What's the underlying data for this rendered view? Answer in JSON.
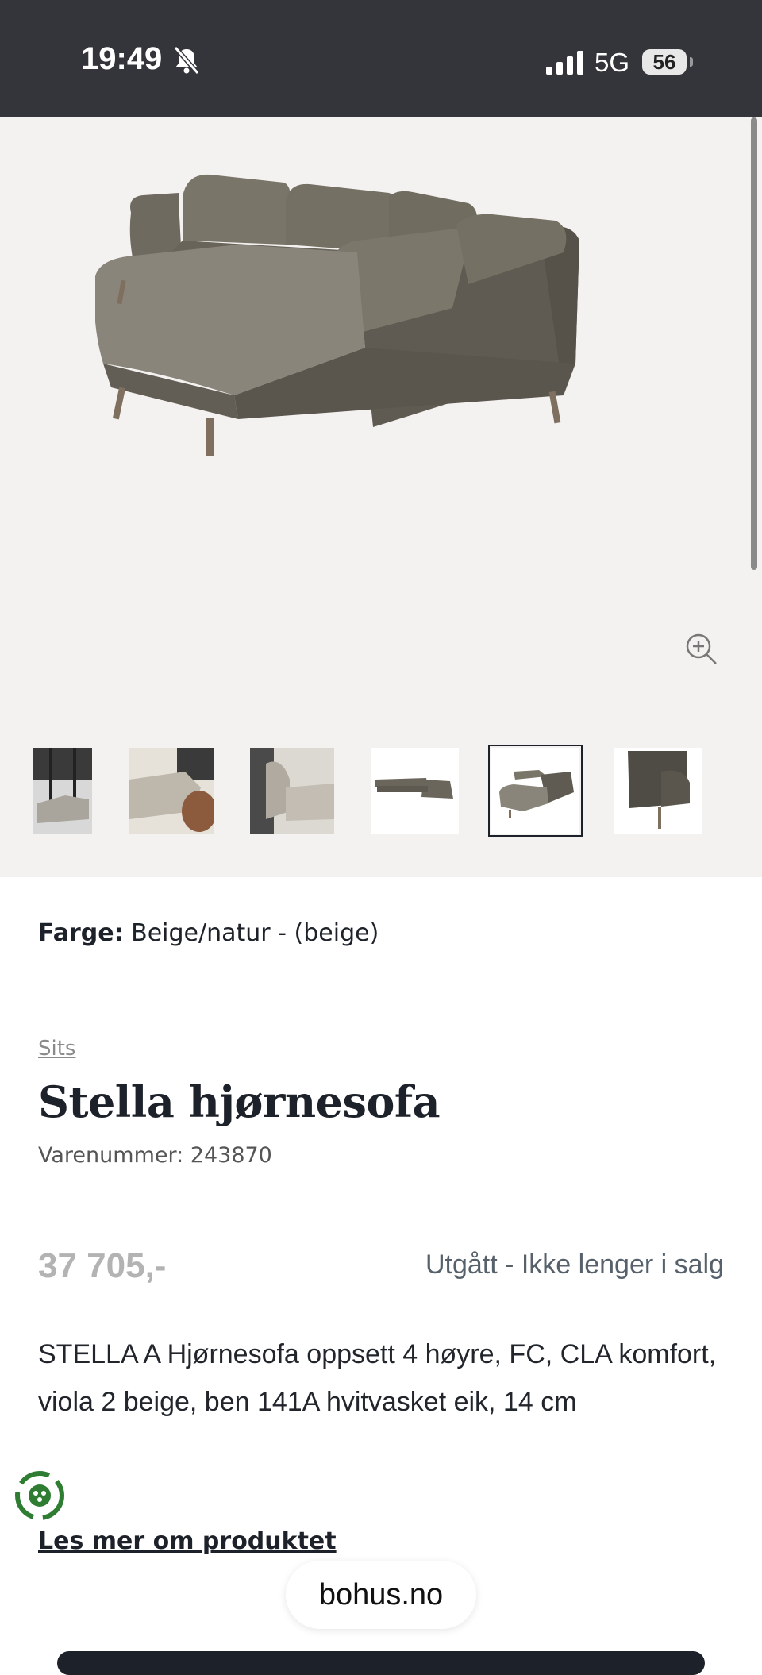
{
  "status_bar": {
    "time": "19:49",
    "network": "5G",
    "battery": "56",
    "icons": [
      "bell-muted-icon",
      "signal-icon"
    ]
  },
  "gallery": {
    "selected_thumbnail": 5,
    "thumbnail_count": 6,
    "icons": [
      "zoom-in-icon"
    ]
  },
  "product": {
    "color_label": "Farge:",
    "color_value": "Beige/natur - (beige)",
    "category": "Sits",
    "title": "Stella hjørnesofa",
    "sku": "Varenummer: 243870",
    "price": "37 705,-",
    "availability": "Utgått - Ikke lenger i salg",
    "description": "STELLA A Hjørnesofa oppsett 4 høyre, FC, CLA komfort, viola 2 beige, ben 141A hvitvasket eik, 14 cm",
    "read_more": "Les mer om produktet"
  },
  "browser": {
    "url": "bohus.no"
  },
  "colors": {
    "status_bar_bg": "#34353a",
    "gallery_bg": "#f4f2f0",
    "title_text": "#1d2129",
    "price_text": "#b3b3b3",
    "availability_text": "#56616b",
    "sofa_fabric": "#6b665c",
    "recycle_green": "#2e7d32"
  }
}
